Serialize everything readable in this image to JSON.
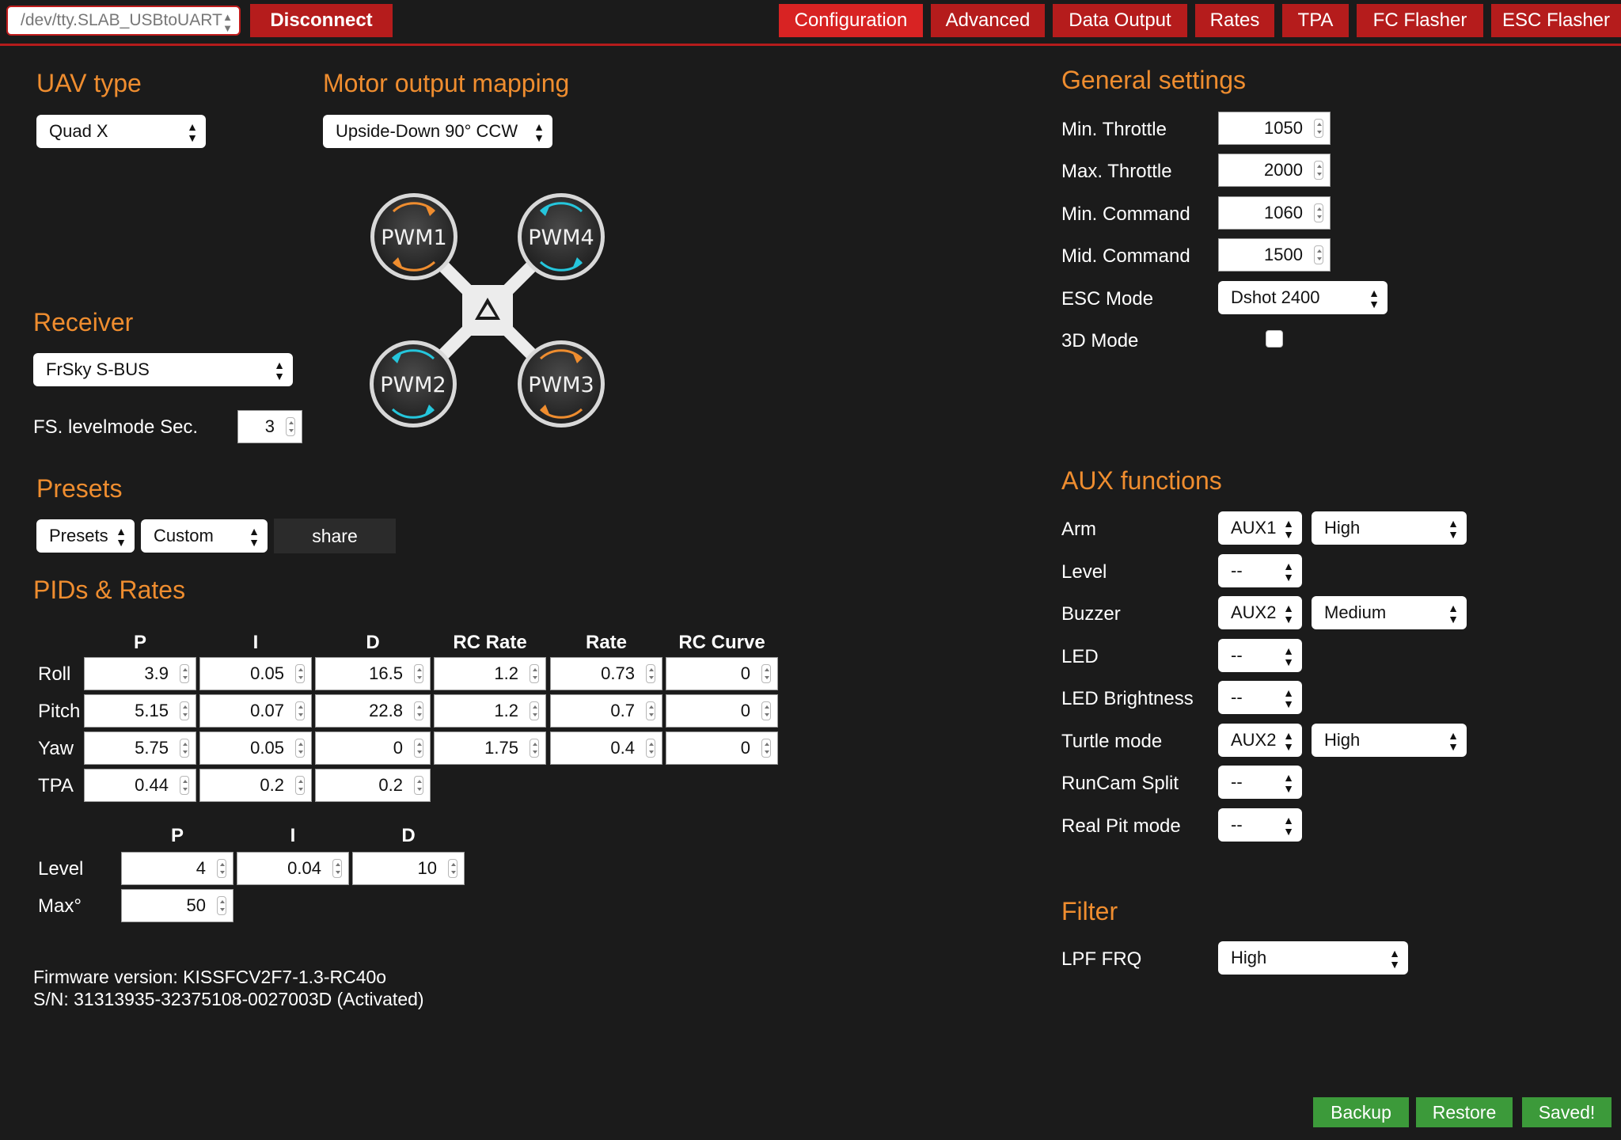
{
  "topbar": {
    "port": "/dev/tty.SLAB_USBtoUART",
    "disconnect": "Disconnect",
    "tabs": [
      "Configuration",
      "Advanced",
      "Data Output",
      "Rates",
      "TPA",
      "FC Flasher",
      "ESC Flasher"
    ],
    "active_tab": "Configuration"
  },
  "uav": {
    "title": "UAV type",
    "value": "Quad X"
  },
  "motor": {
    "title": "Motor output mapping",
    "value": "Upside-Down 90° CCW",
    "motors": [
      "PWM1",
      "PWM4",
      "PWM2",
      "PWM3"
    ]
  },
  "receiver": {
    "title": "Receiver",
    "value": "FrSky S-BUS",
    "fs_label": "FS. levelmode Sec.",
    "fs_value": "3"
  },
  "presets": {
    "title": "Presets",
    "select1": "Presets",
    "select2": "Custom",
    "share": "share"
  },
  "pids": {
    "title": "PIDs & Rates",
    "columns": [
      "P",
      "I",
      "D",
      "RC Rate",
      "Rate",
      "RC Curve"
    ],
    "rows": [
      {
        "name": "Roll",
        "values": [
          "3.9",
          "0.05",
          "16.5",
          "1.2",
          "0.73",
          "0"
        ]
      },
      {
        "name": "Pitch",
        "values": [
          "5.15",
          "0.07",
          "22.8",
          "1.2",
          "0.7",
          "0"
        ]
      },
      {
        "name": "Yaw",
        "values": [
          "5.75",
          "0.05",
          "0",
          "1.75",
          "0.4",
          "0"
        ]
      },
      {
        "name": "TPA",
        "values": [
          "0.44",
          "0.2",
          "0.2"
        ]
      }
    ],
    "level_columns": [
      "P",
      "I",
      "D"
    ],
    "level": {
      "name": "Level",
      "values": [
        "4",
        "0.04",
        "10"
      ]
    },
    "max": {
      "name": "Max°",
      "value": "50"
    }
  },
  "firmware": {
    "version": "Firmware version: KISSFCV2F7-1.3-RC40o",
    "serial": "S/N: 31313935-32375108-0027003D (Activated)"
  },
  "general": {
    "title": "General settings",
    "min_throttle_label": "Min. Throttle",
    "min_throttle": "1050",
    "max_throttle_label": "Max. Throttle",
    "max_throttle": "2000",
    "min_command_label": "Min. Command",
    "min_command": "1060",
    "mid_command_label": "Mid. Command",
    "mid_command": "1500",
    "esc_mode_label": "ESC Mode",
    "esc_mode": "Dshot 2400",
    "mode3d_label": "3D Mode"
  },
  "aux": {
    "title": "AUX functions",
    "items": [
      {
        "label": "Arm",
        "channel": "AUX1",
        "level": "High"
      },
      {
        "label": "Level",
        "channel": "--"
      },
      {
        "label": "Buzzer",
        "channel": "AUX2",
        "level": "Medium"
      },
      {
        "label": "LED",
        "channel": "--"
      },
      {
        "label": "LED Brightness",
        "channel": "--"
      },
      {
        "label": "Turtle mode",
        "channel": "AUX2",
        "level": "High"
      },
      {
        "label": "RunCam Split",
        "channel": "--"
      },
      {
        "label": "Real Pit mode",
        "channel": "--"
      }
    ]
  },
  "filter": {
    "title": "Filter",
    "lpf_label": "LPF FRQ",
    "lpf_value": "High"
  },
  "footer": {
    "backup": "Backup",
    "restore": "Restore",
    "saved": "Saved!"
  },
  "colors": {
    "accent_red": "#b51c1c",
    "active_red": "#d82323",
    "heading_orange": "#ef8d2f",
    "green": "#3c9a3a",
    "background": "#1b1b1b"
  }
}
